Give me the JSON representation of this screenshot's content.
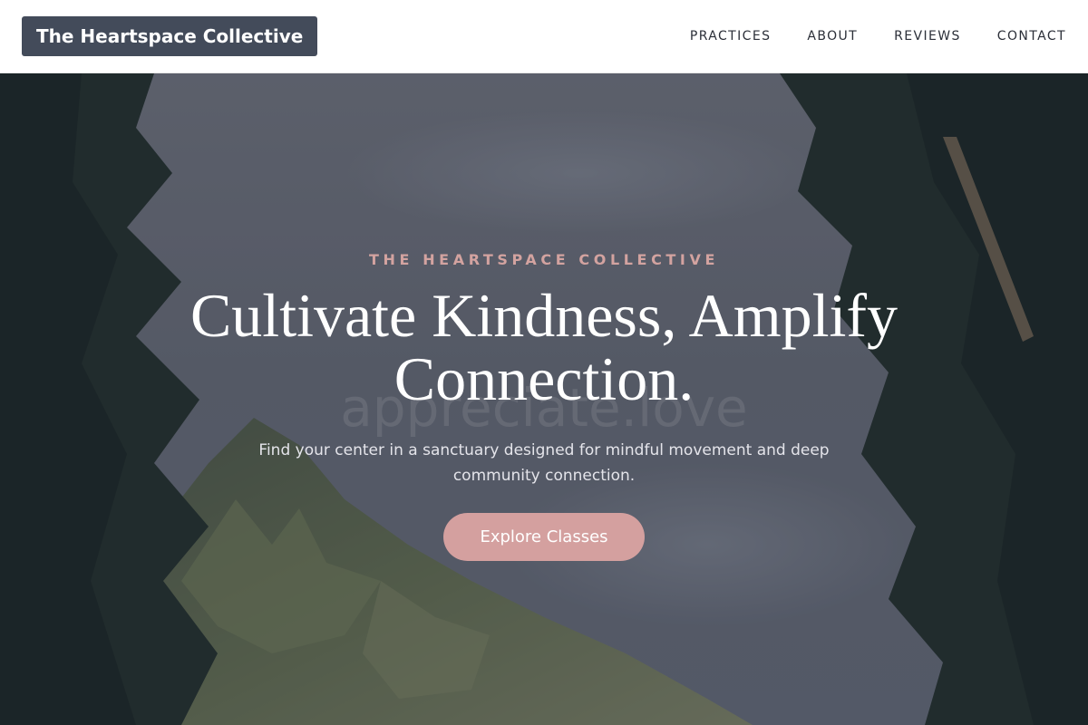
{
  "header": {
    "brand": "The Heartspace Collective",
    "nav": [
      {
        "label": "PRACTICES"
      },
      {
        "label": "ABOUT"
      },
      {
        "label": "REVIEWS"
      },
      {
        "label": "CONTACT"
      }
    ]
  },
  "hero": {
    "eyebrow": "THE HEARTSPACE COLLECTIVE",
    "headline_line1": "Cultivate Kindness, Amplify",
    "headline_line2": "Connection.",
    "watermark": "appreciate.love",
    "subtext": "Find your center in a sanctuary designed for mindful movement and deep community connection.",
    "cta_label": "Explore Classes",
    "background_image": "mountain ridge framed by tree foliage under overcast sky"
  },
  "colors": {
    "brand_bg": "#434b5a",
    "accent_rose": "#d4a09f",
    "eyebrow": "#d3a3a0",
    "nav_text": "#2b2f38"
  }
}
